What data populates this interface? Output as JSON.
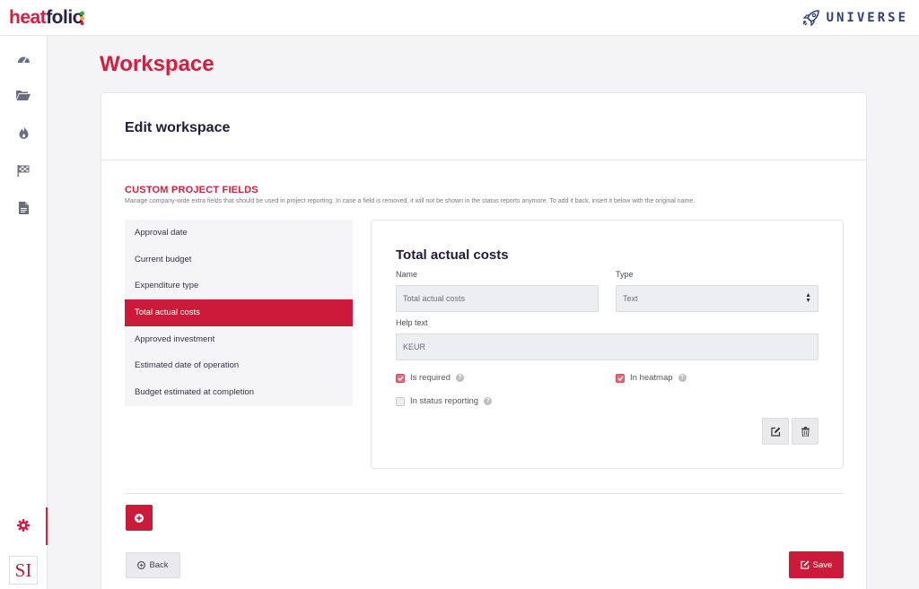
{
  "brand": {
    "logo_part1": "heat",
    "logo_part2": "folio",
    "partner_logo_text": "UNIVERSE",
    "accent_color": "#d81c3f",
    "icon": "rocket-icon"
  },
  "sidebar": {
    "items": [
      {
        "name": "dashboard",
        "icon": "speedometer-icon"
      },
      {
        "name": "projects",
        "icon": "folder-open-icon"
      },
      {
        "name": "heatmap",
        "icon": "flame-icon"
      },
      {
        "name": "milestones",
        "icon": "checkered-flag-icon"
      },
      {
        "name": "reports",
        "icon": "document-icon"
      },
      {
        "name": "settings",
        "icon": "gear-icon",
        "active": true
      }
    ],
    "org_logo_text": "SI"
  },
  "page": {
    "title": "Workspace"
  },
  "card": {
    "title": "Edit workspace",
    "section_title": "CUSTOM PROJECT FIELDS",
    "section_description": "Manage company-wide extra fields that should be used in project reporting. In case a field is removed, it will not be shown in the status reports anymore. To add it back, insert it below with the original name."
  },
  "fields": [
    {
      "label": "Approval date",
      "active": false
    },
    {
      "label": "Current budget",
      "active": false
    },
    {
      "label": "Expenditure type",
      "active": false
    },
    {
      "label": "Total actual costs",
      "active": true
    },
    {
      "label": "Approved investment",
      "active": false
    },
    {
      "label": "Estimated date of operation",
      "active": false
    },
    {
      "label": "Budget estimated at completion",
      "active": false
    }
  ],
  "detail": {
    "title": "Total actual costs",
    "name_label": "Name",
    "name_value": "Total actual costs",
    "type_label": "Type",
    "type_value": "Text",
    "help_label": "Help text",
    "help_value": "KEUR",
    "is_required_label": "Is required",
    "is_required": true,
    "in_heatmap_label": "In heatmap",
    "in_heatmap": true,
    "in_status_label": "In status reporting",
    "in_status": false
  },
  "actions": {
    "back_label": "Back",
    "save_label": "Save"
  }
}
